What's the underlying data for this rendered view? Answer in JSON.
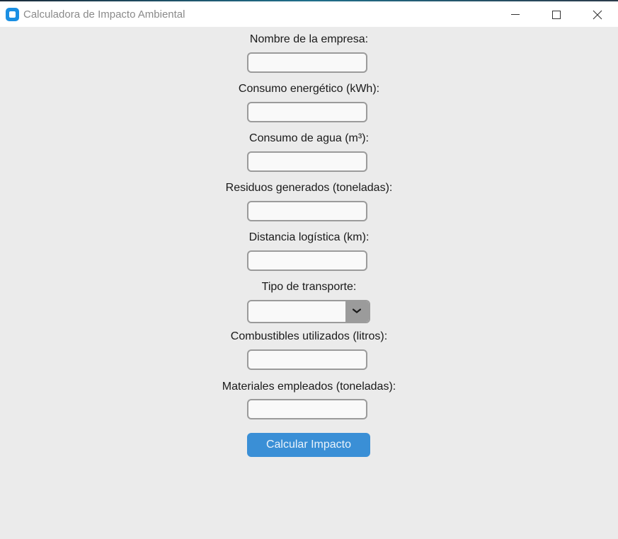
{
  "window": {
    "title": "Calculadora de Impacto Ambiental",
    "icon": "app-icon",
    "controls": [
      "minimize-icon",
      "maximize-icon",
      "close-icon"
    ]
  },
  "colors": {
    "background": "#ebebeb",
    "titlebar": "#ffffff",
    "field_border": "#9b9b9b",
    "field_fill": "#f9f9f9",
    "button": "#3a8fd6",
    "app_icon": "#1a8fe3"
  },
  "form": {
    "fields": [
      {
        "label": "Nombre de la empresa:",
        "value": ""
      },
      {
        "label": "Consumo energético (kWh):",
        "value": ""
      },
      {
        "label": "Consumo de agua (m³):",
        "value": ""
      },
      {
        "label": "Residuos generados (toneladas):",
        "value": ""
      },
      {
        "label": "Distancia logística (km):",
        "value": ""
      },
      {
        "label": "Tipo de transporte:",
        "value": ""
      },
      {
        "label": "Combustibles utilizados (litros):",
        "value": ""
      },
      {
        "label": "Materiales empleados (toneladas):",
        "value": ""
      }
    ],
    "transport_dropdown_icon": "chevron-down-icon",
    "submit_label": "Calcular Impacto"
  }
}
